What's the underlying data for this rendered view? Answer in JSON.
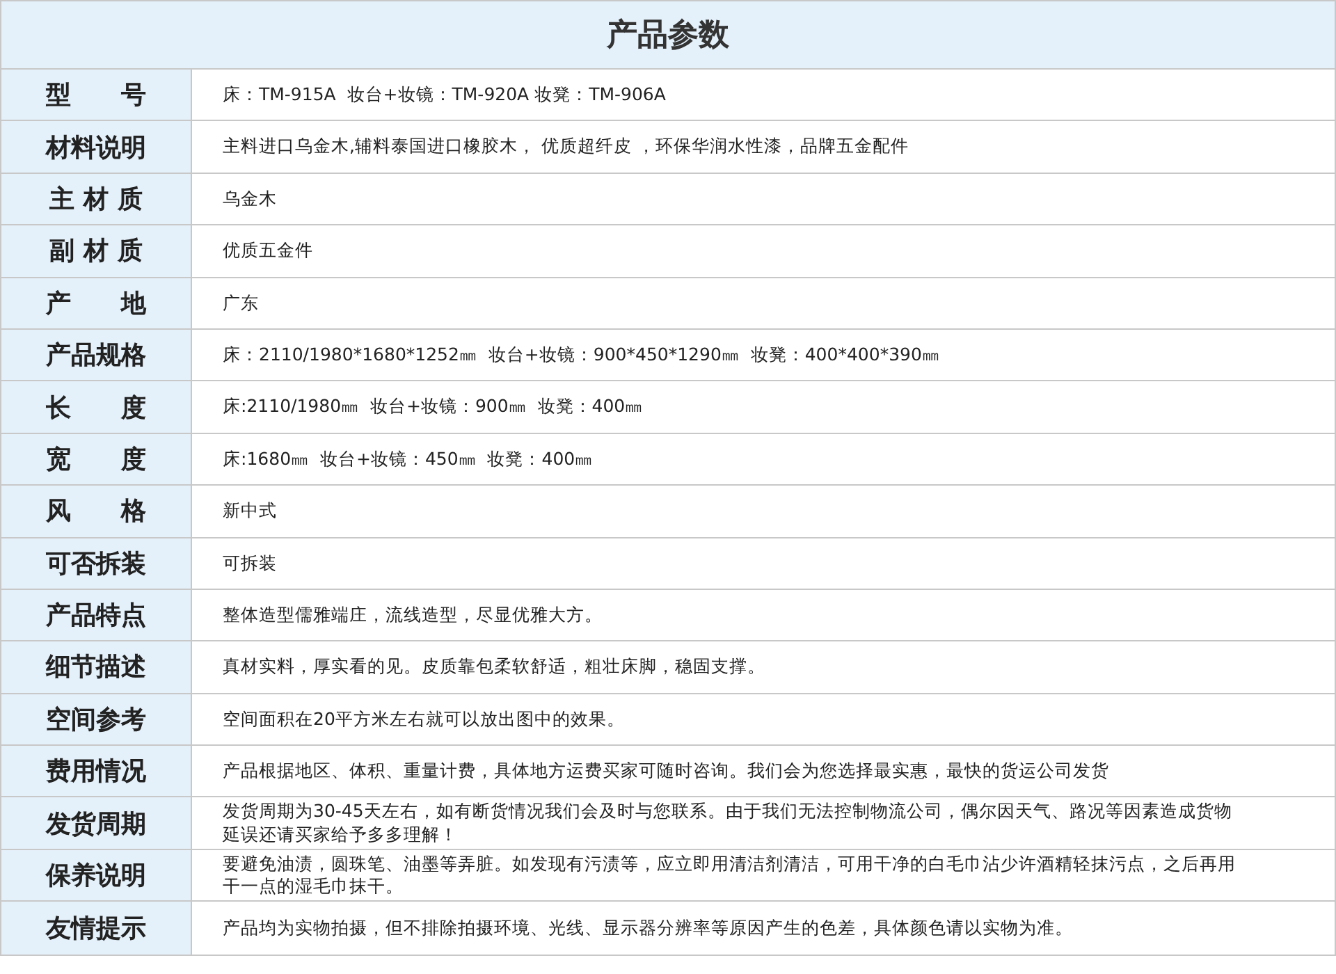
{
  "title": "产品参数",
  "rows": [
    {
      "label": "型　　号",
      "value": "床：TM-915A  妆台+妆镜：TM-920A 妆凳：TM-906A"
    },
    {
      "label": "材料说明",
      "value": "主料进口乌金木,辅料泰国进口橡胶木， 优质超纤皮 ，环保华润水性漆，品牌五金配件"
    },
    {
      "label": "主 材 质",
      "value": "乌金木"
    },
    {
      "label": "副 材 质",
      "value": "优质五金件"
    },
    {
      "label": "产　　地",
      "value": "广东"
    },
    {
      "label": "产品规格",
      "value": "床：2110/1980*1680*1252㎜  妆台+妆镜：900*450*1290㎜  妆凳：400*400*390㎜"
    },
    {
      "label": "长　　度",
      "value": "床:2110/1980㎜  妆台+妆镜：900㎜  妆凳：400㎜"
    },
    {
      "label": "宽　　度",
      "value": "床:1680㎜  妆台+妆镜：450㎜  妆凳：400㎜"
    },
    {
      "label": "风　　格",
      "value": "新中式"
    },
    {
      "label": "可否拆装",
      "value": "可拆装"
    },
    {
      "label": "产品特点",
      "value": "整体造型儒雅端庄，流线造型，尽显优雅大方。"
    },
    {
      "label": "细节描述",
      "value": "真材实料，厚实看的见。皮质靠包柔软舒适，粗壮床脚，稳固支撑。"
    },
    {
      "label": "空间参考",
      "value": "空间面积在20平方米左右就可以放出图中的效果。"
    },
    {
      "label": "费用情况",
      "value": "产品根据地区、体积、重量计费，具体地方运费买家可随时咨询。我们会为您选择最实惠，最快的货运公司发货"
    },
    {
      "label": "发货周期",
      "value": "发货周期为30-45天左右，如有断货情况我们会及时与您联系。由于我们无法控制物流公司，偶尔因天气、路况等因素造成货物延误还请买家给予多多理解！"
    },
    {
      "label": "保养说明",
      "value": "要避免油渍，圆珠笔、油墨等弄脏。如发现有污渍等，应立即用清洁剂清洁，可用干净的白毛巾沾少许酒精轻抹污点，之后再用干一点的湿毛巾抹干。"
    },
    {
      "label": "友情提示",
      "value": "产品均为实物拍摄，但不排除拍摄环境、光线、显示器分辨率等原因产生的色差，具体颜色请以实物为准。"
    }
  ]
}
